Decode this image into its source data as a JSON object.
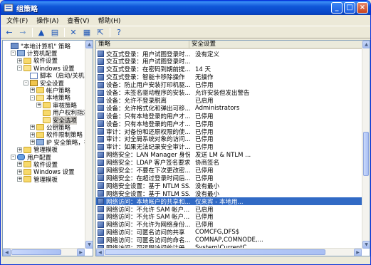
{
  "window": {
    "title": "组策略"
  },
  "menu": [
    "文件(F)",
    "操作(A)",
    "查看(V)",
    "帮助(H)"
  ],
  "toolbar": {
    "back_glyph": "←",
    "forward_glyph": "→",
    "up_glyph": "▲",
    "tree_glyph": "▤",
    "delete_glyph": "✕",
    "properties_glyph": "▦",
    "export_glyph": "⇱",
    "help_glyph": "?"
  },
  "tree": [
    {
      "label": "\"本地计算机\" 策略",
      "level": 0,
      "icon": "policy-root",
      "expander": ""
    },
    {
      "label": "计算机配置",
      "level": 1,
      "icon": "computer",
      "expander": "-"
    },
    {
      "label": "软件设置",
      "level": 2,
      "icon": "folder",
      "expander": "+"
    },
    {
      "label": "Windows 设置",
      "level": 2,
      "icon": "folder-open",
      "expander": "-"
    },
    {
      "label": "脚本（启动/关机）",
      "level": 3,
      "icon": "doc",
      "expander": ""
    },
    {
      "label": "安全设置",
      "level": 3,
      "icon": "book",
      "expander": "-"
    },
    {
      "label": "帐户策略",
      "level": 4,
      "icon": "folder",
      "expander": "+"
    },
    {
      "label": "本地策略",
      "level": 4,
      "icon": "folder-open",
      "expander": "-"
    },
    {
      "label": "审核策略",
      "level": 5,
      "icon": "folder",
      "expander": "+"
    },
    {
      "label": "用户权利指派",
      "level": 5,
      "icon": "folder",
      "expander": ""
    },
    {
      "label": "安全选项",
      "level": 5,
      "icon": "folder-open",
      "expander": "",
      "selected": true
    },
    {
      "label": "公钥策略",
      "level": 4,
      "icon": "folder",
      "expander": "+"
    },
    {
      "label": "软件限制策略",
      "level": 4,
      "icon": "folder",
      "expander": "+"
    },
    {
      "label": "IP 安全策略，在",
      "level": 4,
      "icon": "computer",
      "expander": "+"
    },
    {
      "label": "管理模板",
      "level": 2,
      "icon": "folder",
      "expander": "+"
    },
    {
      "label": "用户配置",
      "level": 1,
      "icon": "user",
      "expander": "-"
    },
    {
      "label": "软件设置",
      "level": 2,
      "icon": "folder",
      "expander": "+"
    },
    {
      "label": "Windows 设置",
      "level": 2,
      "icon": "folder",
      "expander": "+"
    },
    {
      "label": "管理模板",
      "level": 2,
      "icon": "folder",
      "expander": "+"
    }
  ],
  "list": {
    "headers": {
      "policy": "策略",
      "setting": "安全设置"
    },
    "rows": [
      {
        "policy": "交互式登录：用户试图登录时...",
        "setting": "没有定义"
      },
      {
        "policy": "交互式登录：用户试图登录时...",
        "setting": ""
      },
      {
        "policy": "交互式登录：在密码到期前提...",
        "setting": "14 天"
      },
      {
        "policy": "交互式登录：智能卡移除操作",
        "setting": "无操作"
      },
      {
        "policy": "设备：防止用户安装打印机驱...",
        "setting": "已停用"
      },
      {
        "policy": "设备：未签名驱动程序的安装...",
        "setting": "允许安装但发出警告"
      },
      {
        "policy": "设备：允许不登录脱离",
        "setting": "已启用"
      },
      {
        "policy": "设备：允许格式化和弹出可移...",
        "setting": "Administrators"
      },
      {
        "policy": "设备：只有本地登录的用户才...",
        "setting": "已停用"
      },
      {
        "policy": "设备：只有本地登录的用户才...",
        "setting": "已停用"
      },
      {
        "policy": "审计：对备份和还原权限的使...",
        "setting": "已停用"
      },
      {
        "policy": "审计：对全局系统对象的访问...",
        "setting": "已停用"
      },
      {
        "policy": "审计：如果无法纪录安全审计...",
        "setting": "已停用"
      },
      {
        "policy": "网络安全：LAN Manager 身份...",
        "setting": "发送 LM & NTLM ..."
      },
      {
        "policy": "网络安全：LDAP 客户签名要求",
        "setting": "协商签名"
      },
      {
        "policy": "网络安全：不要在下次更改密...",
        "setting": "已停用"
      },
      {
        "policy": "网络安全：在超过登录时间后...",
        "setting": "已停用"
      },
      {
        "policy": "网络安全设置：基于 NTLM SS...",
        "setting": "没有最小"
      },
      {
        "policy": "网络安全设置：基于 NTLM SS...",
        "setting": "没有最小"
      },
      {
        "policy": "网络访问：本地帐户的共享和...",
        "setting": "仅来宾 - 本地用...",
        "selected": true
      },
      {
        "policy": "网络访问：不允许 SAM 帐户...",
        "setting": "已启用"
      },
      {
        "policy": "网络访问：不允许 SAM 帐户...",
        "setting": "已停用"
      },
      {
        "policy": "网络访问：不允许为网络身份...",
        "setting": "已停用"
      },
      {
        "policy": "网络访问：可匿名访问的共享",
        "setting": "COMCFG,DFS$"
      },
      {
        "policy": "网络访问：可匿名访问的命名...",
        "setting": "COMNAP,COMNODE,..."
      },
      {
        "policy": "网络访问：可远程访问的注册...",
        "setting": "System\\CurrentC..."
      }
    ]
  },
  "colors": {
    "titlebar": "#0a50d4",
    "selection": "#316ac5",
    "chrome": "#ece9d8"
  }
}
